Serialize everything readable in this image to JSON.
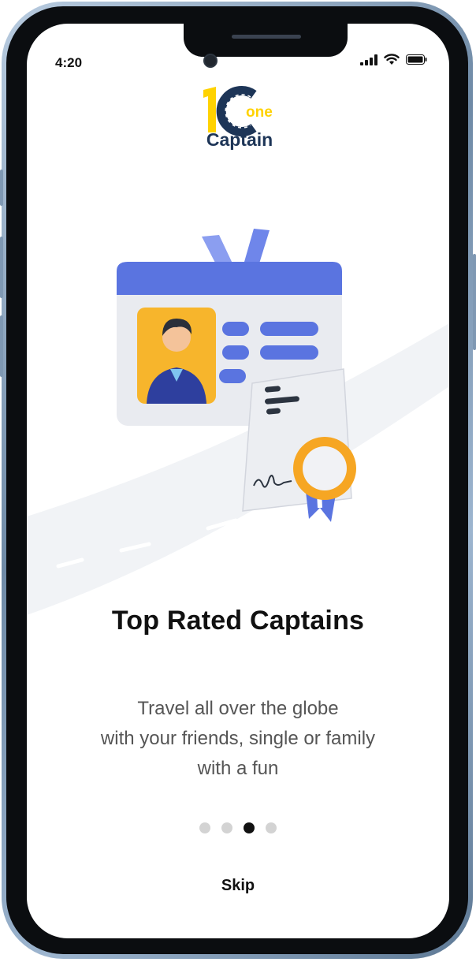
{
  "status_bar": {
    "time": "4:20"
  },
  "logo": {
    "mark": "1C",
    "word_top": "one",
    "word_bottom": "Captain"
  },
  "slide": {
    "title": "Top Rated Captains",
    "description": "Travel all over the globe\nwith your friends,  single or family\nwith a fun"
  },
  "pager": {
    "count": 4,
    "active_index": 2
  },
  "skip_label": "Skip",
  "colors": {
    "accent_blue": "#5a74e0",
    "logo_yellow": "#ffd200",
    "logo_navy": "#1d3557"
  }
}
